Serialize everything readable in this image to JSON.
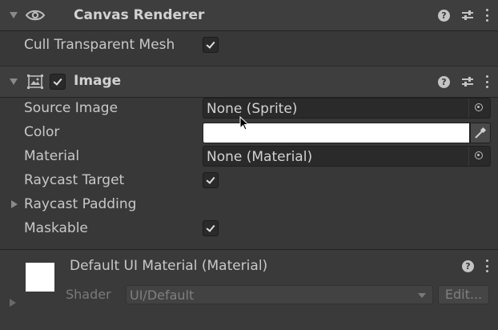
{
  "canvas_renderer": {
    "title": "Canvas Renderer",
    "cull_label": "Cull Transparent Mesh",
    "cull_checked": true,
    "help_glyph": "?"
  },
  "image": {
    "title": "Image",
    "enabled": true,
    "help_glyph": "?",
    "source_image_label": "Source Image",
    "source_image_value": "None (Sprite)",
    "color_label": "Color",
    "color_value": "#FFFFFF",
    "material_label": "Material",
    "material_value": "None (Material)",
    "raycast_target_label": "Raycast Target",
    "raycast_target_checked": true,
    "raycast_padding_label": "Raycast Padding",
    "maskable_label": "Maskable",
    "maskable_checked": true
  },
  "material_section": {
    "title": "Default UI Material (Material)",
    "help_glyph": "?",
    "shader_label": "Shader",
    "shader_value": "UI/Default",
    "edit_label": "Edit..."
  },
  "icons": {
    "header1": [
      "foldout-arrow-icon",
      "eye-icon",
      "help-icon",
      "presets-icon",
      "kebab-menu-icon"
    ],
    "header2": [
      "foldout-arrow-icon",
      "image-component-icon",
      "enable-checkbox",
      "help-icon",
      "presets-icon",
      "kebab-menu-icon"
    ],
    "fields": [
      "object-picker-icon",
      "eyedropper-icon",
      "foldout-right-arrow-icon",
      "dropdown-arrow-icon",
      "mouse-cursor-icon"
    ]
  }
}
